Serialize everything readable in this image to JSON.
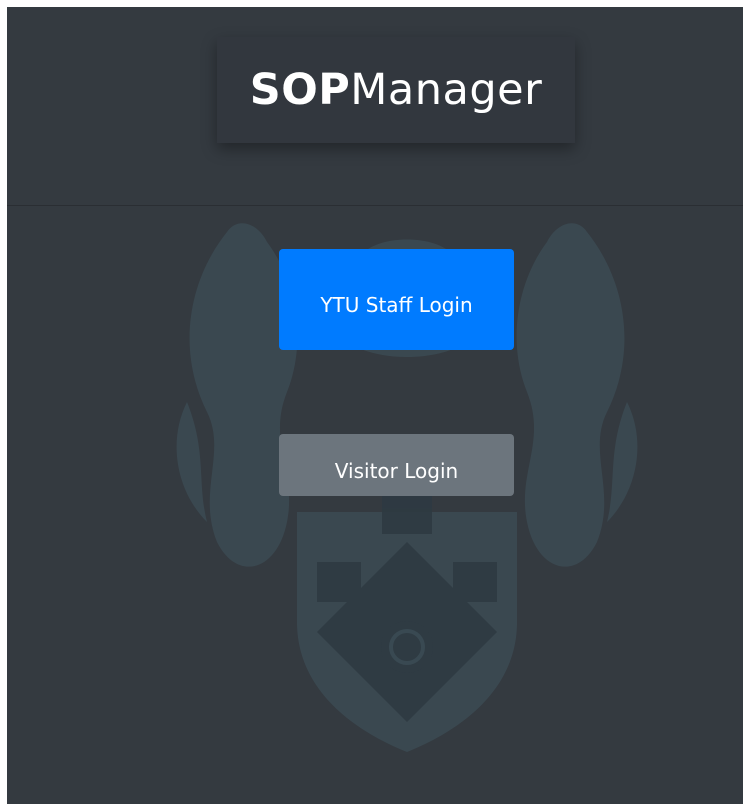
{
  "logo": {
    "bold": "SOP",
    "light": "Manager"
  },
  "buttons": {
    "staff_login": "YTU Staff Login",
    "visitor_login": "Visitor Login"
  },
  "colors": {
    "background": "#343a40",
    "primary": "#007bff",
    "secondary": "#6c757d",
    "crest": "#3c4d56"
  },
  "icons": {
    "crest": "university-crest-watermark"
  }
}
